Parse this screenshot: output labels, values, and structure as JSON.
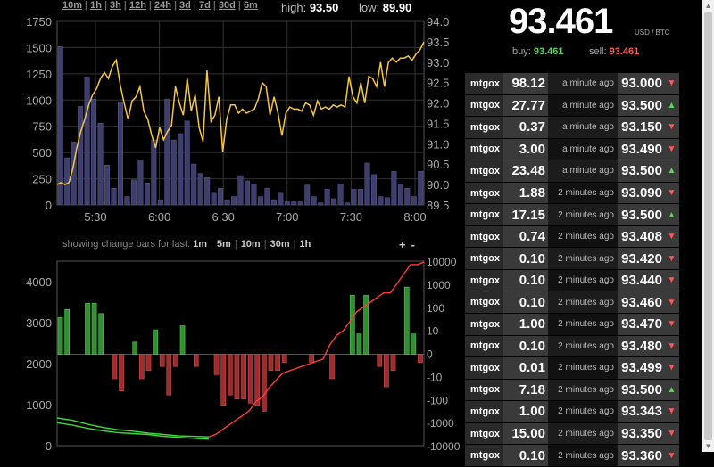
{
  "timeframes": [
    "10m",
    "1h",
    "3h",
    "12h",
    "24h",
    "3d",
    "7d",
    "30d",
    "6m"
  ],
  "stats": {
    "high_label": "high:",
    "high": "93.50",
    "low_label": "low:",
    "low": "89.90"
  },
  "ticker": {
    "price": "93.461",
    "currency": "USD / BTC",
    "buy_label": "buy:",
    "buy": "93.461",
    "sell_label": "sell:",
    "sell": "93.461"
  },
  "change_bars": {
    "label": "showing change bars for last:",
    "options": [
      "1m",
      "5m",
      "10m",
      "30m",
      "1h"
    ],
    "zoom_in": "+",
    "zoom_out": "-"
  },
  "colors": {
    "price_line": "#f5c642",
    "volume_bar": "#3e3e6e",
    "up": "#3aa83a",
    "down": "#b83535",
    "red_line": "#ff3b3b",
    "green_line": "#3bdc3b"
  },
  "trades": [
    {
      "exchange": "mtgox",
      "amount": "98.12",
      "time": "a minute ago",
      "price": "93.000",
      "dir": "down"
    },
    {
      "exchange": "mtgox",
      "amount": "27.77",
      "time": "a minute ago",
      "price": "93.500",
      "dir": "up"
    },
    {
      "exchange": "mtgox",
      "amount": "0.37",
      "time": "a minute ago",
      "price": "93.150",
      "dir": "down"
    },
    {
      "exchange": "mtgox",
      "amount": "3.00",
      "time": "a minute ago",
      "price": "93.490",
      "dir": "down"
    },
    {
      "exchange": "mtgox",
      "amount": "23.48",
      "time": "a minute ago",
      "price": "93.500",
      "dir": "up"
    },
    {
      "exchange": "mtgox",
      "amount": "1.88",
      "time": "2 minutes ago",
      "price": "93.090",
      "dir": "down"
    },
    {
      "exchange": "mtgox",
      "amount": "17.15",
      "time": "2 minutes ago",
      "price": "93.500",
      "dir": "up"
    },
    {
      "exchange": "mtgox",
      "amount": "0.74",
      "time": "2 minutes ago",
      "price": "93.408",
      "dir": "down"
    },
    {
      "exchange": "mtgox",
      "amount": "0.10",
      "time": "2 minutes ago",
      "price": "93.420",
      "dir": "down"
    },
    {
      "exchange": "mtgox",
      "amount": "0.10",
      "time": "2 minutes ago",
      "price": "93.440",
      "dir": "down"
    },
    {
      "exchange": "mtgox",
      "amount": "0.10",
      "time": "2 minutes ago",
      "price": "93.460",
      "dir": "down"
    },
    {
      "exchange": "mtgox",
      "amount": "1.00",
      "time": "2 minutes ago",
      "price": "93.470",
      "dir": "down"
    },
    {
      "exchange": "mtgox",
      "amount": "0.10",
      "time": "2 minutes ago",
      "price": "93.480",
      "dir": "down"
    },
    {
      "exchange": "mtgox",
      "amount": "0.01",
      "time": "2 minutes ago",
      "price": "93.499",
      "dir": "down"
    },
    {
      "exchange": "mtgox",
      "amount": "7.18",
      "time": "2 minutes ago",
      "price": "93.500",
      "dir": "up"
    },
    {
      "exchange": "mtgox",
      "amount": "1.00",
      "time": "2 minutes ago",
      "price": "93.343",
      "dir": "down"
    },
    {
      "exchange": "mtgox",
      "amount": "15.00",
      "time": "2 minutes ago",
      "price": "93.350",
      "dir": "down"
    },
    {
      "exchange": "mtgox",
      "amount": "0.10",
      "time": "2 minutes ago",
      "price": "93.360",
      "dir": "down"
    }
  ],
  "chart_data": [
    {
      "type": "bar+line",
      "x_ticks": [
        "5:30",
        "6:00",
        "6:30",
        "7:00",
        "7:30",
        "8:00"
      ],
      "y_left_ticks": [
        0,
        250,
        500,
        750,
        1000,
        1250,
        1500,
        1750
      ],
      "y_right_ticks": [
        89.5,
        90.0,
        90.5,
        91.0,
        91.5,
        92.0,
        92.5,
        93.0,
        93.5,
        94.0
      ],
      "ylim_left": [
        0,
        1750
      ],
      "ylim_right": [
        89.5,
        94.0
      ],
      "volume": [
        1510,
        450,
        600,
        940,
        1220,
        1010,
        780,
        380,
        160,
        980,
        80,
        240,
        430,
        210,
        620,
        50,
        1010,
        620,
        680,
        800,
        390,
        300,
        260,
        120,
        160,
        50,
        80,
        280,
        230,
        200,
        80,
        160,
        50,
        120,
        30,
        40,
        30,
        190,
        80,
        20,
        150,
        60,
        200,
        20,
        150,
        150,
        400,
        290,
        80,
        70,
        320,
        200,
        160,
        80,
        320
      ],
      "price": [
        90.0,
        90.05,
        90.0,
        90.05,
        90.4,
        90.9,
        91.3,
        91.6,
        91.95,
        92.2,
        92.35,
        92.6,
        92.75,
        92.6,
        92.9,
        93.05,
        92.45,
        92.0,
        91.6,
        92.05,
        92.15,
        92.4,
        91.8,
        91.6,
        91.2,
        90.9,
        91.4,
        91.1,
        91.3,
        91.45,
        92.4,
        92.0,
        91.7,
        92.6,
        91.8,
        92.2,
        91.4,
        91.05,
        92.8,
        91.55,
        91.7,
        92.15,
        90.8,
        91.6,
        91.95,
        91.95,
        91.75,
        91.85,
        91.75,
        91.8,
        91.85,
        92.1,
        92.5,
        92.4,
        91.7,
        92.15,
        91.75,
        91.2,
        91.75,
        91.9,
        91.85,
        91.85,
        91.8,
        92.0,
        91.95,
        91.7,
        92.05,
        91.85,
        91.9,
        91.85,
        91.95,
        91.9,
        91.95,
        91.9,
        92.65,
        92.15,
        92.0,
        92.5,
        92.0,
        92.65,
        92.6,
        92.4,
        93.0,
        92.4,
        93.0,
        93.1,
        93.0,
        93.1,
        93.1,
        93.15,
        93.05,
        93.2,
        93.3,
        93.5
      ]
    },
    {
      "type": "bar+line",
      "y_left_ticks": [
        0,
        1000,
        2000,
        3000,
        4000
      ],
      "ylim_left": [
        0,
        4500
      ],
      "y_right_ticks": [
        "10000",
        "1000",
        "100",
        "10",
        "0",
        "-10",
        "-100",
        "-1000",
        "-10000"
      ],
      "change_bars": [
        0.9,
        1.1,
        0,
        0,
        1.25,
        1.25,
        1.0,
        0,
        -0.6,
        -0.9,
        0,
        0.3,
        -0.6,
        -0.4,
        0.6,
        -0.3,
        -1.0,
        -0.3,
        0.7,
        0,
        -0.3,
        0,
        0,
        -0.5,
        -1.25,
        -1.0,
        -1.1,
        -1.1,
        -1.2,
        -1.25,
        -1.4,
        -0.4,
        -0.4,
        -0.2,
        0,
        0,
        0,
        -0.2,
        0,
        0,
        -0.6,
        0,
        0,
        1.45,
        0.5,
        1.45,
        0,
        -0.3,
        -0.8,
        -0.4,
        0,
        1.65,
        0.5,
        -0.2
      ],
      "red_line": [
        -1.75,
        -1.7,
        -1.6,
        -1.5,
        -1.4,
        -1.3,
        -1.2,
        -1.0,
        -0.9,
        -0.7,
        -0.55,
        -0.4,
        -0.35,
        -0.3,
        -0.25,
        -0.2,
        -0.15,
        -0.1,
        0.2,
        0.4,
        0.5,
        0.7,
        0.9,
        1.0,
        1.1,
        1.2,
        1.3,
        1.3,
        1.5,
        1.7,
        1.9,
        1.9,
        1.95
      ],
      "green_line": [
        -1.35,
        -1.4,
        -1.48,
        -1.55,
        -1.6,
        -1.63,
        -1.67,
        -1.7,
        -1.73,
        -1.74,
        -1.75
      ],
      "green_line2": [
        -1.45,
        -1.5,
        -1.57,
        -1.62,
        -1.66,
        -1.68,
        -1.7,
        -1.74,
        -1.76,
        -1.78,
        -1.8
      ]
    }
  ]
}
